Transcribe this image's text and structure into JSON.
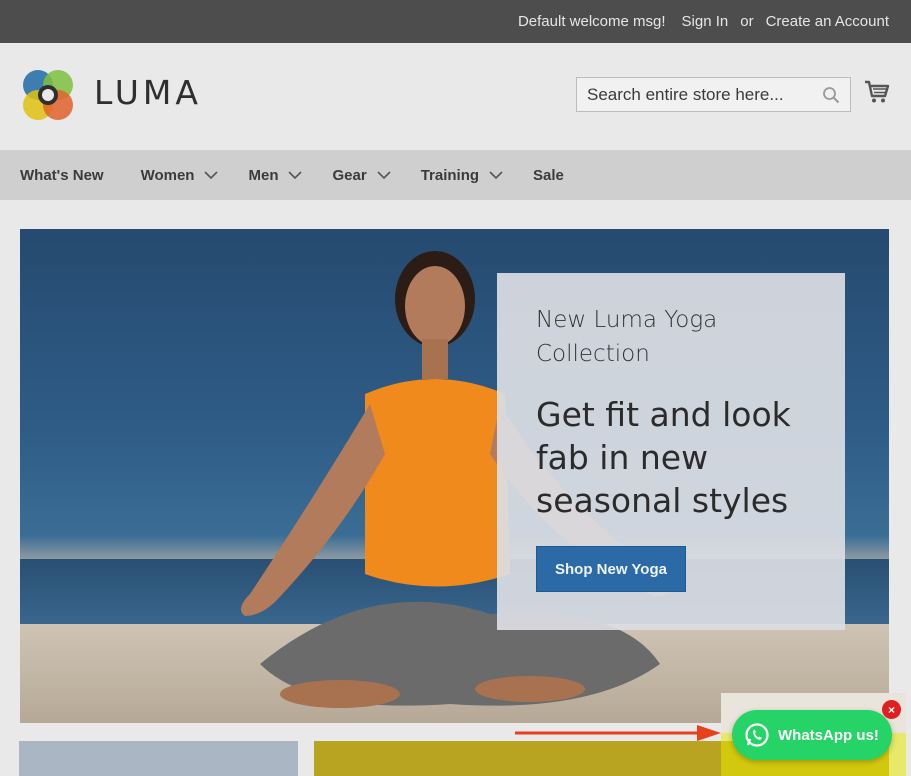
{
  "topbar": {
    "welcome": "Default welcome msg!",
    "sign_in": "Sign In",
    "or": "or",
    "create_account": "Create an Account"
  },
  "header": {
    "logo_text": "LUMA",
    "search_placeholder": "Search entire store here...",
    "cart_icon": "cart-icon",
    "search_icon": "search-icon"
  },
  "nav": {
    "items": [
      {
        "label": "What's New",
        "has_dropdown": false
      },
      {
        "label": "Women",
        "has_dropdown": true
      },
      {
        "label": "Men",
        "has_dropdown": true
      },
      {
        "label": "Gear",
        "has_dropdown": true
      },
      {
        "label": "Training",
        "has_dropdown": true
      },
      {
        "label": "Sale",
        "has_dropdown": false
      }
    ]
  },
  "hero": {
    "kicker": "New Luma Yoga Collection",
    "headline": "Get fit and look fab in new seasonal styles",
    "cta": "Shop New Yoga"
  },
  "whatsapp": {
    "label": "WhatsApp us!",
    "close": "×"
  },
  "colors": {
    "topbar": "#4d4d4d",
    "nav": "#cfcfcf",
    "cta": "#2b6aa6",
    "whatsapp": "#25d366",
    "close": "#e02020",
    "arrow": "#e8401c"
  }
}
